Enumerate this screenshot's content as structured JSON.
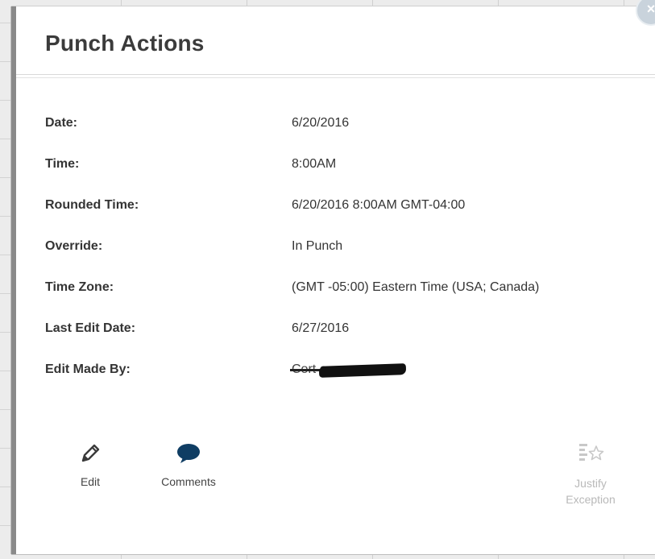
{
  "dialog": {
    "title": "Punch Actions",
    "close_label": "×"
  },
  "details": [
    {
      "label": "Date:",
      "value": "6/20/2016"
    },
    {
      "label": "Time:",
      "value": "8:00AM"
    },
    {
      "label": "Rounded Time:",
      "value": "6/20/2016 8:00AM GMT-04:00"
    },
    {
      "label": "Override:",
      "value": "In Punch"
    },
    {
      "label": "Time Zone:",
      "value": "(GMT -05:00) Eastern Time (USA; Canada)"
    },
    {
      "label": "Last Edit Date:",
      "value": "6/27/2016"
    },
    {
      "label": "Edit Made By:",
      "value": "Cort e"
    }
  ],
  "actions": {
    "edit_label": "Edit",
    "comments_label": "Comments",
    "justify_line1": "Justify",
    "justify_line2": "Exception"
  },
  "icons": {
    "edit": "pencil-icon",
    "comments": "speech-bubble-icon",
    "justify": "justify-exception-icon",
    "close": "close-icon"
  },
  "colors": {
    "title": "#3b3b3b",
    "text": "#343434",
    "disabled": "#b9b9b9",
    "close_bg": "#c9d3dc"
  }
}
